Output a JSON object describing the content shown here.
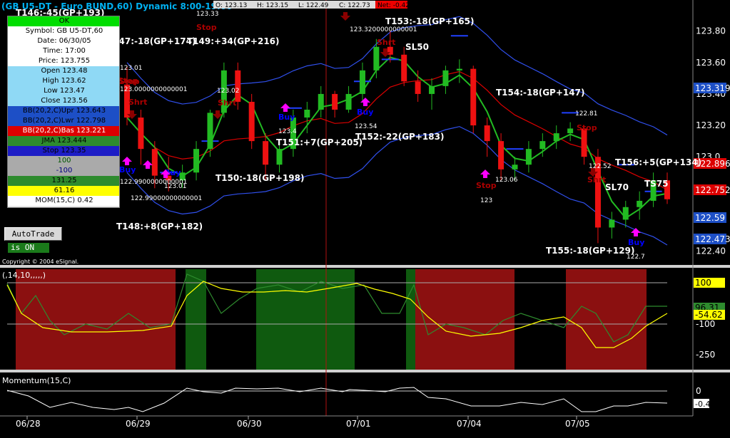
{
  "header": {
    "symbol_title": "(GB U5-DT - Euro BUND,60) Dynamic 8:00-19:00",
    "open_lbl": "O: 123.13",
    "high_lbl": "H: 123.15",
    "low_lbl": "L: 122.49",
    "close_lbl": "C: 122.73",
    "net_lbl": "Net: -0.42"
  },
  "infobox": {
    "rows": [
      {
        "text": "OK",
        "bg": "#00dd00",
        "fg": "#000000"
      },
      {
        "text": "Symbol: GB U5-DT,60",
        "bg": "#ffffff",
        "fg": "#000000"
      },
      {
        "text": "Date: 06/30/05",
        "bg": "#ffffff",
        "fg": "#000000"
      },
      {
        "text": "Time: 17:00",
        "bg": "#ffffff",
        "fg": "#000000"
      },
      {
        "text": "Price: 123.755",
        "bg": "#ffffff",
        "fg": "#000000"
      },
      {
        "text": "Open 123.48",
        "bg": "#8fd9f5",
        "fg": "#000000"
      },
      {
        "text": "High 123.62",
        "bg": "#8fd9f5",
        "fg": "#000000"
      },
      {
        "text": "Low 123.47",
        "bg": "#8fd9f5",
        "fg": "#000000"
      },
      {
        "text": "Close 123.56",
        "bg": "#8fd9f5",
        "fg": "#000000"
      },
      {
        "text": "BB(20,2,C)Upr 123.643",
        "bg": "#1d4fc6",
        "fg": "#000000"
      },
      {
        "text": "BB(20,2,C)Lwr 122.798",
        "bg": "#1d4fc6",
        "fg": "#000000"
      },
      {
        "text": "BB(20,2,C)Bas 123.221",
        "bg": "#dd0000",
        "fg": "#ffffff"
      },
      {
        "text": "JMA 123.444",
        "bg": "#2e8b2e",
        "fg": "#000000"
      },
      {
        "text": "Stop 123.35",
        "bg": "#1d1dc6",
        "fg": "#000000"
      },
      {
        "text": "100",
        "bg": "#aaaaaa",
        "fg": "#005500"
      },
      {
        "text": "-100",
        "bg": "#aaaaaa",
        "fg": "#000080"
      },
      {
        "text": "131.25",
        "bg": "#2e8b2e",
        "fg": "#000000"
      },
      {
        "text": "61.16",
        "bg": "#ffff00",
        "fg": "#000000"
      },
      {
        "text": "MOM(15,C) 0.42",
        "bg": "#ffffff",
        "fg": "#000000"
      }
    ]
  },
  "autotrade": {
    "button_label": "AutoTrade",
    "status_label": "is ON"
  },
  "copyright": "Copyright © 2004 eSignal.",
  "price_axis": {
    "ticks": [
      "123.80",
      "123.60",
      "123.40",
      "123.20",
      "123.0",
      "122.80",
      "122.60",
      "122.40"
    ],
    "badges": [
      {
        "text": "123.319",
        "bg": "#1d4fc6",
        "fg": "#ffffff"
      },
      {
        "text": "122.896",
        "bg": "#dd0000",
        "fg": "#ffffff"
      },
      {
        "text": "122.752",
        "bg": "#dd0000",
        "fg": "#ffffff"
      },
      {
        "text": "122.59",
        "bg": "#1d4fc6",
        "fg": "#ffffff"
      },
      {
        "text": "122.473",
        "bg": "#1d4fc6",
        "fg": "#ffffff"
      }
    ]
  },
  "cci_panel": {
    "title": "(,14,10,,,,,)",
    "ticks": [
      "100",
      "-100",
      "-250"
    ],
    "badges": [
      {
        "text": "100",
        "bg": "#ffff00",
        "fg": "#000000"
      },
      {
        "text": "96.31",
        "bg": "#2e8b2e",
        "fg": "#000000"
      },
      {
        "text": "-54.62",
        "bg": "#ffff00",
        "fg": "#000000"
      }
    ]
  },
  "mom_panel": {
    "title": "Momentum(15,C)",
    "ticks": [
      "0"
    ],
    "badges": [
      {
        "text": "-0.4",
        "bg": "#ffffff",
        "fg": "#000000"
      }
    ]
  },
  "date_axis": {
    "labels": [
      "06/28",
      "06/29",
      "06/30",
      "07/01",
      "07/04",
      "07/05"
    ]
  },
  "trade_labels": [
    "T146:-45(GP+193)",
    "T147:-18(GP+174)",
    "T149:+34(GP+216)",
    "T153:-18(GP+165)",
    "T154:-18(GP+147)",
    "T151:+7(GP+205)",
    "T152:-22(GP+183)",
    "T150:-18(GP+198)",
    "T156:+5(GP+134)",
    "T148:+8(GP+182)",
    "T155:-18(GP+129)",
    "SL50",
    "SL70",
    "TS75"
  ],
  "signal_labels": [
    "Stop",
    "Stop",
    "Shrt",
    "Shrt",
    "Buy",
    "Shrt",
    "Buy",
    "Buy",
    "Buy",
    "Stop",
    "Shrt",
    "Buy",
    "Stop",
    "Stop"
  ],
  "price_notes": [
    "123.33",
    "123.01",
    "123.02",
    "123.3200000000001",
    "123.4",
    "123.54",
    "123.01",
    "122.99000000000001",
    "123.06",
    "123",
    "122.81",
    "122.52",
    "122.7",
    "123.0000000000001",
    "122.9900000000001"
  ],
  "chart_data": {
    "type": "candlestick",
    "title": "(GB U5-DT - Euro BUND,60) Dynamic 8:00-19:00",
    "ylim": [
      122.33,
      123.93
    ],
    "x_labels": [
      "06/28",
      "06/29",
      "06/30",
      "07/01",
      "07/04",
      "07/05"
    ],
    "candles": [
      [
        123.46,
        123.58,
        123.2,
        123.25
      ],
      [
        123.25,
        123.3,
        122.95,
        123.05
      ],
      [
        123.05,
        123.1,
        122.8,
        122.88
      ],
      [
        122.88,
        123.0,
        122.78,
        122.85
      ],
      [
        122.85,
        122.95,
        122.8,
        122.9
      ],
      [
        122.9,
        123.1,
        122.85,
        123.05
      ],
      [
        123.05,
        123.3,
        123.0,
        123.28
      ],
      [
        123.28,
        123.6,
        123.25,
        123.55
      ],
      [
        123.55,
        123.6,
        123.3,
        123.35
      ],
      [
        123.35,
        123.4,
        123.05,
        123.1
      ],
      [
        123.1,
        123.15,
        122.85,
        122.95
      ],
      [
        122.95,
        123.1,
        122.9,
        123.05
      ],
      [
        123.05,
        123.3,
        123.0,
        123.25
      ],
      [
        123.25,
        123.35,
        123.15,
        123.3
      ],
      [
        123.3,
        123.45,
        123.25,
        123.4
      ],
      [
        123.4,
        123.42,
        123.25,
        123.3
      ],
      [
        123.3,
        123.45,
        123.28,
        123.4
      ],
      [
        123.4,
        123.6,
        123.35,
        123.55
      ],
      [
        123.55,
        123.75,
        123.5,
        123.7
      ],
      [
        123.7,
        123.8,
        123.6,
        123.65
      ],
      [
        123.65,
        123.7,
        123.45,
        123.48
      ],
      [
        123.48,
        123.55,
        123.35,
        123.4
      ],
      [
        123.4,
        123.5,
        123.3,
        123.45
      ],
      [
        123.45,
        123.58,
        123.4,
        123.55
      ],
      [
        123.55,
        123.62,
        123.47,
        123.56
      ],
      [
        123.56,
        123.58,
        123.15,
        123.2
      ],
      [
        123.2,
        123.25,
        123.0,
        123.1
      ],
      [
        123.1,
        123.15,
        122.85,
        122.92
      ],
      [
        122.92,
        123.0,
        122.85,
        122.95
      ],
      [
        122.95,
        123.1,
        122.9,
        123.05
      ],
      [
        123.05,
        123.15,
        123.0,
        123.1
      ],
      [
        123.1,
        123.2,
        123.05,
        123.15
      ],
      [
        123.15,
        123.22,
        123.1,
        123.18
      ],
      [
        123.18,
        123.2,
        122.95,
        123.0
      ],
      [
        123.0,
        123.05,
        122.45,
        122.55
      ],
      [
        122.55,
        122.65,
        122.48,
        122.6
      ],
      [
        122.6,
        122.72,
        122.55,
        122.68
      ],
      [
        122.68,
        122.78,
        122.6,
        122.72
      ],
      [
        122.72,
        122.9,
        122.68,
        122.85
      ],
      [
        122.85,
        122.9,
        122.7,
        122.73
      ]
    ],
    "momentum_last": -0.4,
    "cci_levels": [
      100,
      -100,
      -250
    ]
  },
  "colors": {
    "bull": "#22bb22",
    "bear": "#ee1111",
    "bb_band": "#3050ee",
    "bb_basis": "#dd0000",
    "jma": "#22bb22",
    "stop": "#2040ff",
    "cci": "#2e8b2e",
    "cci_signal": "#ffff00",
    "bg_bull": "#0f5a0f",
    "bg_bear": "#8b1010"
  }
}
